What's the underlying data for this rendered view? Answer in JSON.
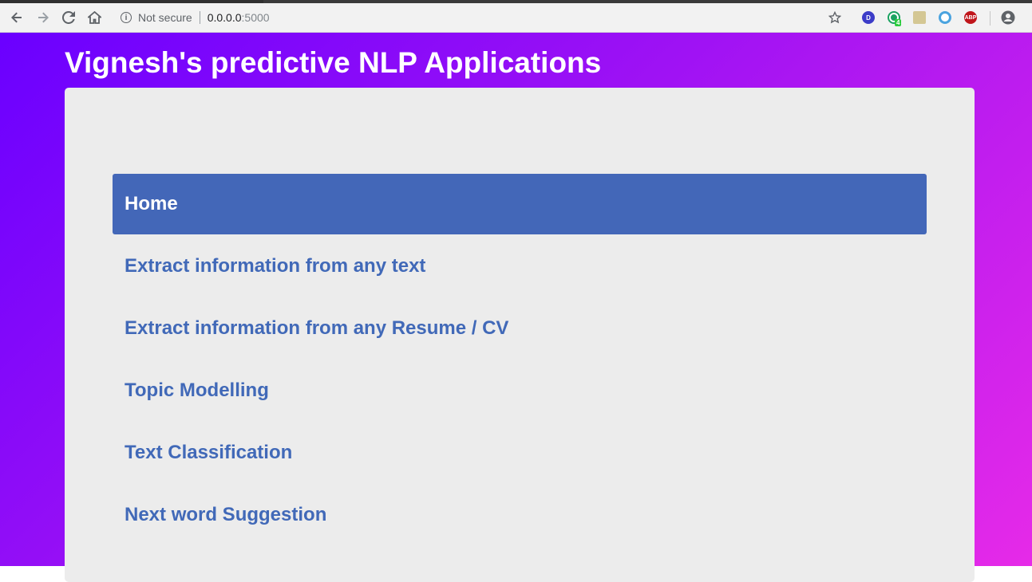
{
  "browser": {
    "security_label": "Not secure",
    "url_host": "0.0.0.0",
    "url_port": ":5000",
    "extensions": [
      {
        "name": "D",
        "color": "#3c3cc8"
      },
      {
        "name": "4",
        "color": "#1aa260"
      },
      {
        "name": "",
        "color": "#c8b46e"
      },
      {
        "name": "",
        "color": "#4aa3df"
      },
      {
        "name": "ABP",
        "color": "#c0151b"
      }
    ]
  },
  "page": {
    "title": "Vignesh's predictive NLP Applications"
  },
  "nav": {
    "items": [
      {
        "label": "Home",
        "active": true
      },
      {
        "label": "Extract information from any text",
        "active": false
      },
      {
        "label": "Extract information from any Resume / CV",
        "active": false
      },
      {
        "label": "Topic Modelling",
        "active": false
      },
      {
        "label": "Text Classification",
        "active": false
      },
      {
        "label": "Next word Suggestion",
        "active": false
      }
    ]
  }
}
